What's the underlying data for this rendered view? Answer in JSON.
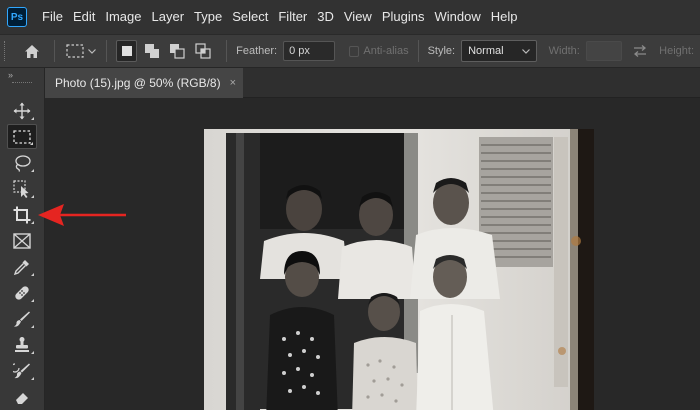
{
  "app": {
    "logo_text": "Ps",
    "menu": [
      "File",
      "Edit",
      "Image",
      "Layer",
      "Type",
      "Select",
      "Filter",
      "3D",
      "View",
      "Plugins",
      "Window",
      "Help"
    ]
  },
  "options_bar": {
    "feather_label": "Feather:",
    "feather_value": "0 px",
    "antialias_label": "Anti-alias",
    "style_label": "Style:",
    "style_value": "Normal",
    "width_label": "Width:",
    "height_label": "Height:"
  },
  "document": {
    "tab_title": "Photo (15).jpg @ 50% (RGB/8)",
    "close_symbol": "×"
  },
  "toolbar": {
    "collapse_symbol": "»",
    "tools": [
      "move",
      "rectangular-marquee",
      "lasso",
      "object-selection",
      "crop",
      "frame",
      "eyedropper",
      "spot-healing-brush",
      "brush",
      "clone-stamp",
      "history-brush"
    ],
    "active_tool": "rectangular-marquee"
  },
  "annotation": {
    "arrow_color": "#e52521",
    "points_to": "crop-tool"
  },
  "colors": {
    "menubar": "#323232",
    "options_bar": "#3c3c3c",
    "toolbar": "#383838",
    "canvas": "#282828",
    "ps_blue": "#31a8ff"
  }
}
